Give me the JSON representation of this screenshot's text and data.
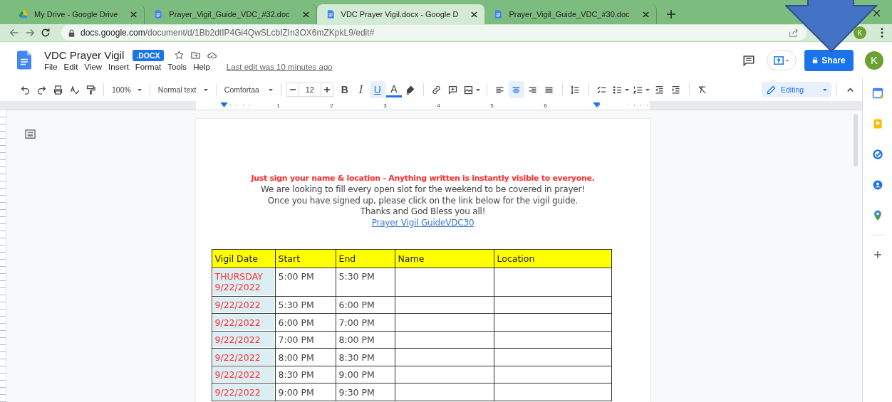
{
  "browser": {
    "tabs": [
      {
        "title": "My Drive - Google Drive",
        "kind": "drive",
        "selected": false
      },
      {
        "title": "Prayer_Vigil_Guide_VDC_#32.doc",
        "kind": "doc",
        "selected": false
      },
      {
        "title": "VDC Prayer Vigil.docx - Google D",
        "kind": "doc",
        "selected": true
      },
      {
        "title": "Prayer_Vigil_Guide_VDC_#30.doc",
        "kind": "doc",
        "selected": false
      }
    ],
    "url_host": "docs.google.com",
    "url_path": "/document/d/1Bb2dtIP4Gi4QwSLcbIZIn3OX6mZKpkL9/edit#",
    "profile": "K"
  },
  "header": {
    "title": "VDC Prayer Vigil",
    "badge": ".DOCX",
    "menu": [
      "File",
      "Edit",
      "View",
      "Insert",
      "Format",
      "Tools",
      "Help"
    ],
    "last_edit": "Last edit was 10 minutes ago",
    "share": "Share",
    "avatar": "K"
  },
  "toolbar": {
    "zoom": "100%",
    "style": "Normal text",
    "font": "Comfortaa",
    "font_size": "12",
    "format": [
      {
        "label": "B",
        "selected": false
      },
      {
        "label": "I",
        "selected": false
      },
      {
        "label": "U",
        "selected": true
      },
      {
        "label": "A",
        "selected": false
      }
    ],
    "align": [
      {
        "selected": false
      },
      {
        "selected": true
      },
      {
        "selected": false
      },
      {
        "selected": false
      }
    ],
    "mode": "Editing"
  },
  "ruler": [
    "1",
    "2",
    "3",
    "4",
    "5",
    "6",
    "7"
  ],
  "document": {
    "lines": [
      {
        "text": "Just sign your name & location - Anything written is instantly visible to everyone.",
        "kind": "notice"
      },
      {
        "text": "We are looking to fill every open slot for the weekend to be covered in prayer!",
        "kind": "plain"
      },
      {
        "text": "Once you have signed up, please click on the link below for the vigil guide.",
        "kind": "plain"
      },
      {
        "text": "Thanks and God Bless you all!",
        "kind": "plain"
      },
      {
        "text": "Prayer Vigil GuideVDC30",
        "kind": "link"
      }
    ],
    "table": {
      "columns": [
        "Vigil Date",
        "Start",
        "End",
        "Name",
        "Location"
      ],
      "rows": [
        {
          "day": "THURSDAY",
          "date": "9/22/2022",
          "start": "5:00 PM",
          "end": "5:30 PM"
        },
        {
          "date": "9/22/2022",
          "start": "5:30 PM",
          "end": "6:00 PM"
        },
        {
          "date": "9/22/2022",
          "start": "6:00 PM",
          "end": "7:00 PM"
        },
        {
          "date": "9/22/2022",
          "start": "7:00 PM",
          "end": "8:00 PM"
        },
        {
          "date": "9/22/2022",
          "start": "8:00 PM",
          "end": "8:30 PM"
        },
        {
          "date": "9/22/2022",
          "start": "8:30 PM",
          "end": "9:00 PM"
        },
        {
          "date": "9/22/2022",
          "start": "9:00 PM",
          "end": "9:30 PM"
        }
      ]
    }
  }
}
